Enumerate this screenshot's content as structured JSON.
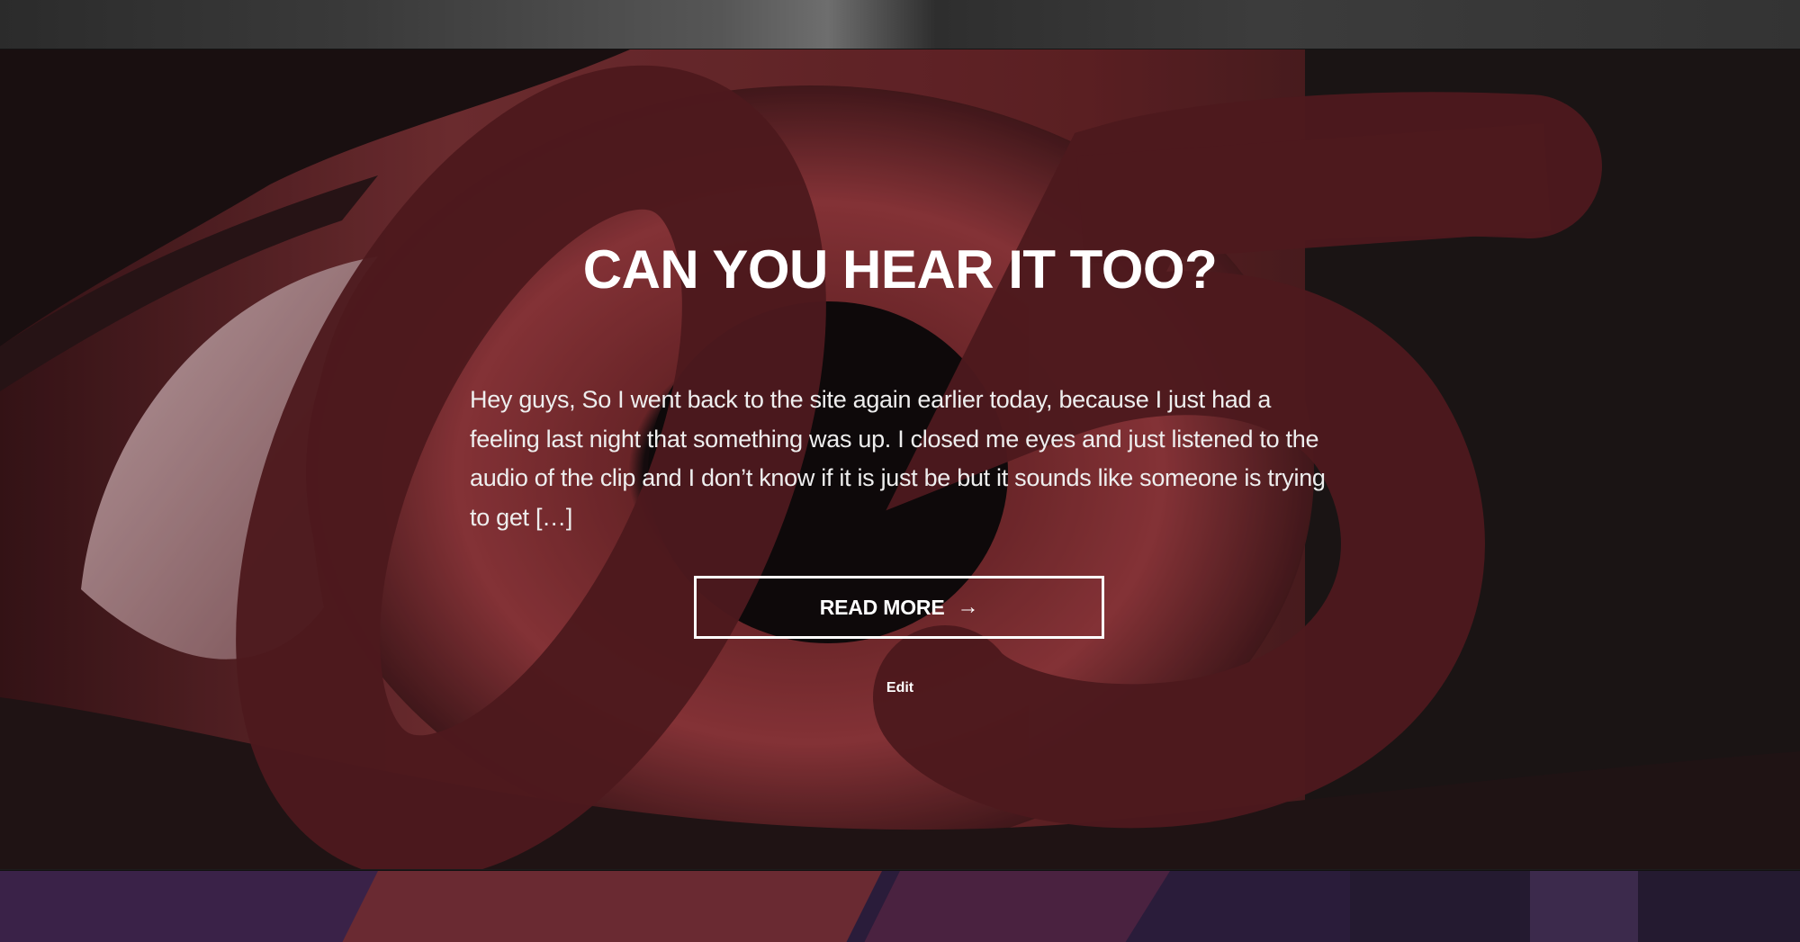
{
  "post": {
    "title": "CAN YOU HEAR IT TOO?",
    "excerpt": "Hey guys, So I went back to the site again earlier today, because I just had a feeling last night that something was up. I closed me eyes and just listened to the audio of the clip and I don’t know if it is just be but it sounds like someone is trying to get […]",
    "read_more_label": "READ MORE",
    "read_more_arrow": "→",
    "edit_label": "Edit"
  },
  "colors": {
    "accent_red": "#5a1d22",
    "text": "#ffffff",
    "page_bg": "#1c1c1c"
  },
  "icons": {
    "read_more_arrow": "arrow-right-icon"
  }
}
